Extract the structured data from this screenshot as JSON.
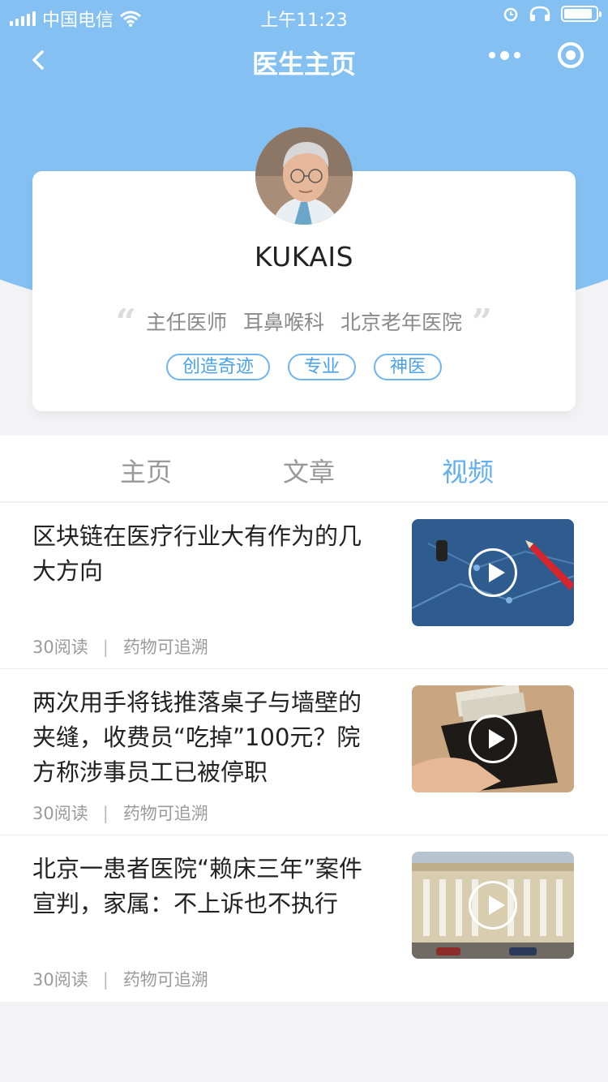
{
  "status_bar": {
    "carrier": "中国电信",
    "time": "上午11:23"
  },
  "navbar": {
    "title": "医生主页",
    "icons": [
      "back-icon",
      "more-icon",
      "target-icon"
    ]
  },
  "doctor": {
    "name": "KUKAIS",
    "title": "主任医师",
    "department": "耳鼻喉科",
    "hospital": "北京老年医院",
    "tags": [
      "创造奇迹",
      "专业",
      "神医"
    ]
  },
  "tabs": [
    {
      "label": "主页",
      "active": false
    },
    {
      "label": "文章",
      "active": false
    },
    {
      "label": "视频",
      "active": true
    }
  ],
  "articles": [
    {
      "title": "区块链在医疗行业大有作为的几大方向",
      "reads": "30阅读",
      "source": "药物可追溯",
      "thumb": "blockchain-video-thumbnail"
    },
    {
      "title": "两次用手将钱推落桌子与墙壁的夹缝，收费员“吃掉”100元？院方称涉事员工已被停职",
      "reads": "30阅读",
      "source": "药物可追溯",
      "thumb": "wallet-money-video-thumbnail"
    },
    {
      "title": "北京一患者医院“赖床三年”案件宣判，家属：不上诉也不执行",
      "reads": "30阅读",
      "source": "药物可追溯",
      "thumb": "hospital-building-video-thumbnail"
    }
  ],
  "colors": {
    "header_blue": "#84c1f2",
    "accent_blue": "#61aef0",
    "tag_blue": "#4aa2ea"
  }
}
